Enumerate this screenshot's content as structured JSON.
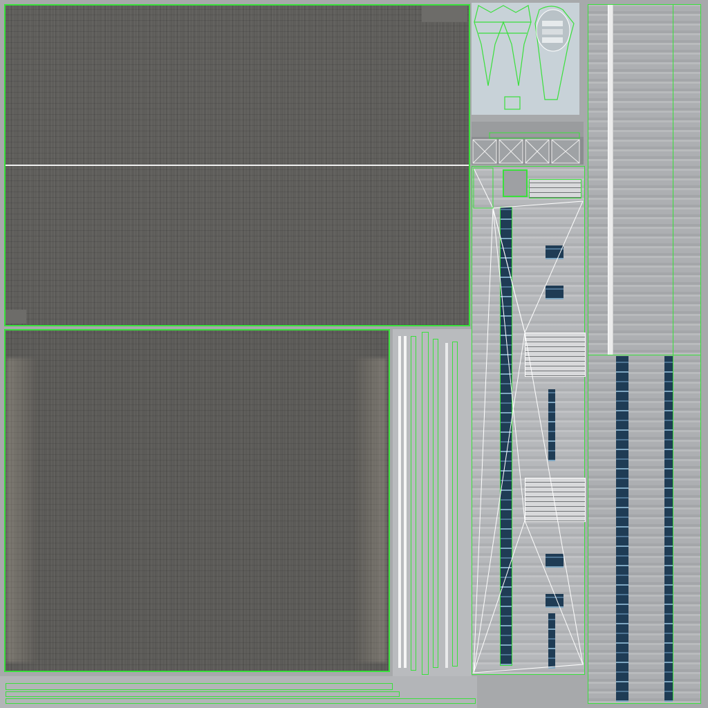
{
  "atlas": {
    "outline_color": "#39e03b",
    "roof_color": "#5f5e5b",
    "facade_color": "#b6b8bb",
    "glass_color": "#26435d",
    "detail_color": "#d3dde3"
  }
}
